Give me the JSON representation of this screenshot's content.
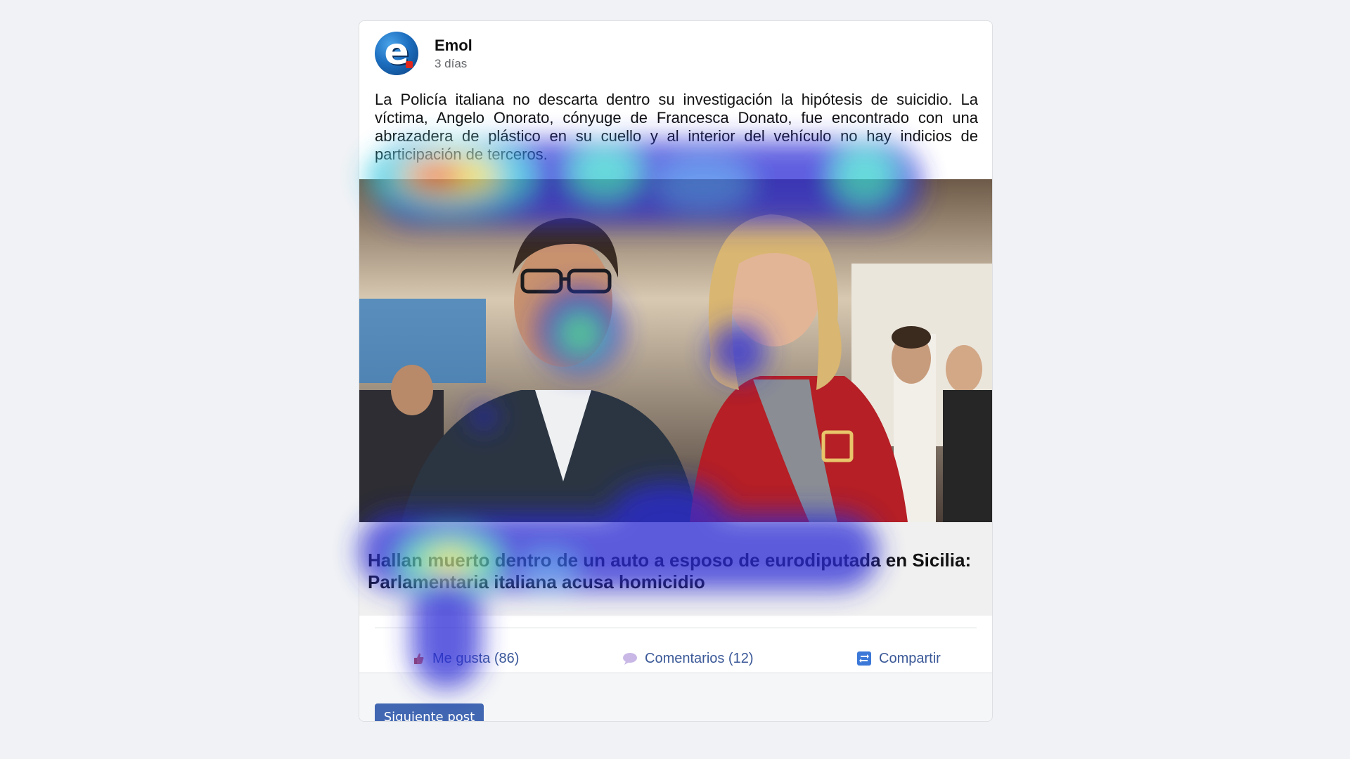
{
  "post": {
    "author": "Emol",
    "time": "3 días",
    "logo_icon": "emol-logo",
    "text": "La Policía italiana no descarta dentro su investigación la hipótesis de suicidio. La víctima, Angelo Onorato, cónyuge de Francesca Donato, fue encontrado con una abrazadera de plástico en su cuello y al interior del vehículo no hay indicios de participación de terceros.",
    "link_title": "Hallan muerto dentro de un auto a esposo de eurodiputada en Sicilia: Parlamentaria italiana acusa homicidio"
  },
  "actions": {
    "like_label": "Me gusta (86)",
    "like_icon": "like-icon",
    "comment_label": "Comentarios (12)",
    "comment_icon": "comment-icon",
    "share_label": "Compartir",
    "share_icon": "share-icon",
    "color": "#3b5998"
  },
  "footer": {
    "next_label": "Siguiente post",
    "button_color": "#4267b2"
  }
}
